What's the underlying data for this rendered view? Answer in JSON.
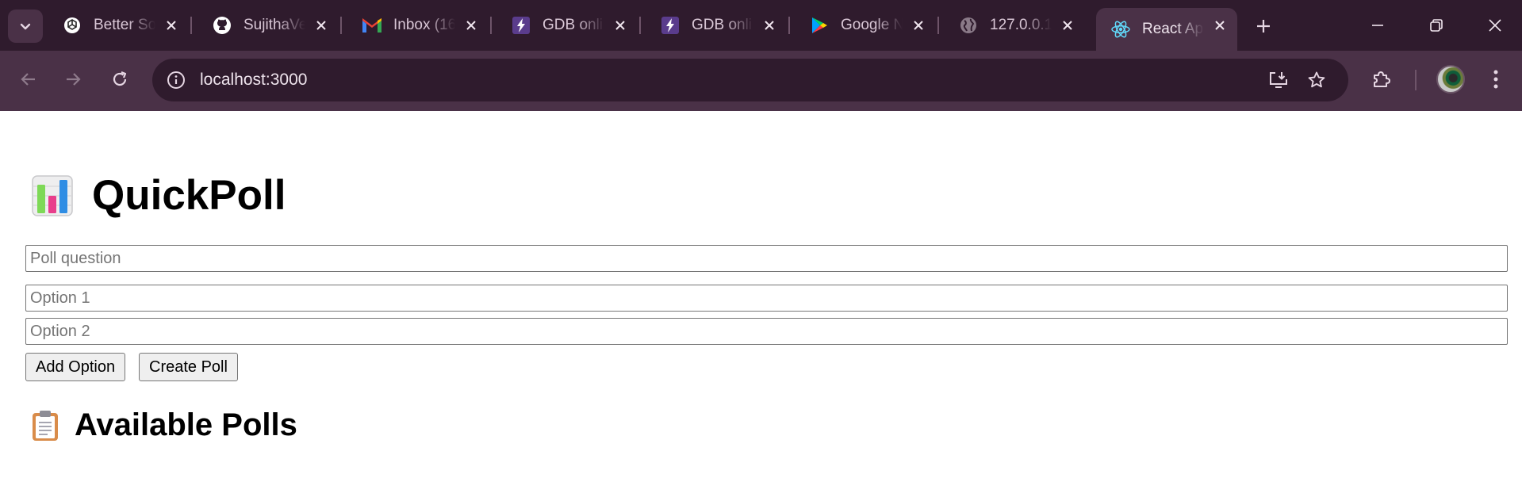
{
  "browser": {
    "tabs": [
      {
        "title": "Better So",
        "icon": "openai-icon"
      },
      {
        "title": "SujithaVe",
        "icon": "github-icon"
      },
      {
        "title": "Inbox (16",
        "icon": "gmail-icon"
      },
      {
        "title": "GDB onli",
        "icon": "lightning-icon"
      },
      {
        "title": "GDB onli",
        "icon": "lightning-icon"
      },
      {
        "title": "Google N",
        "icon": "google-play-icon"
      },
      {
        "title": "127.0.0.1",
        "icon": "globe-icon"
      },
      {
        "title": "React Ap",
        "icon": "react-icon"
      }
    ],
    "active_tab_index": 7,
    "url": "localhost:3000"
  },
  "app": {
    "title": "QuickPoll",
    "title_icon": "bar-chart-emoji-icon",
    "question_placeholder": "Poll question",
    "option1_placeholder": "Option 1",
    "option2_placeholder": "Option 2",
    "add_option_label": "Add Option",
    "create_poll_label": "Create Poll",
    "polls_heading": "Available Polls",
    "polls_heading_icon": "clipboard-emoji-icon"
  },
  "colors": {
    "tabstrip": "#2f1b2d",
    "toolbar": "#4a3147",
    "page_background": "#ffffff"
  }
}
